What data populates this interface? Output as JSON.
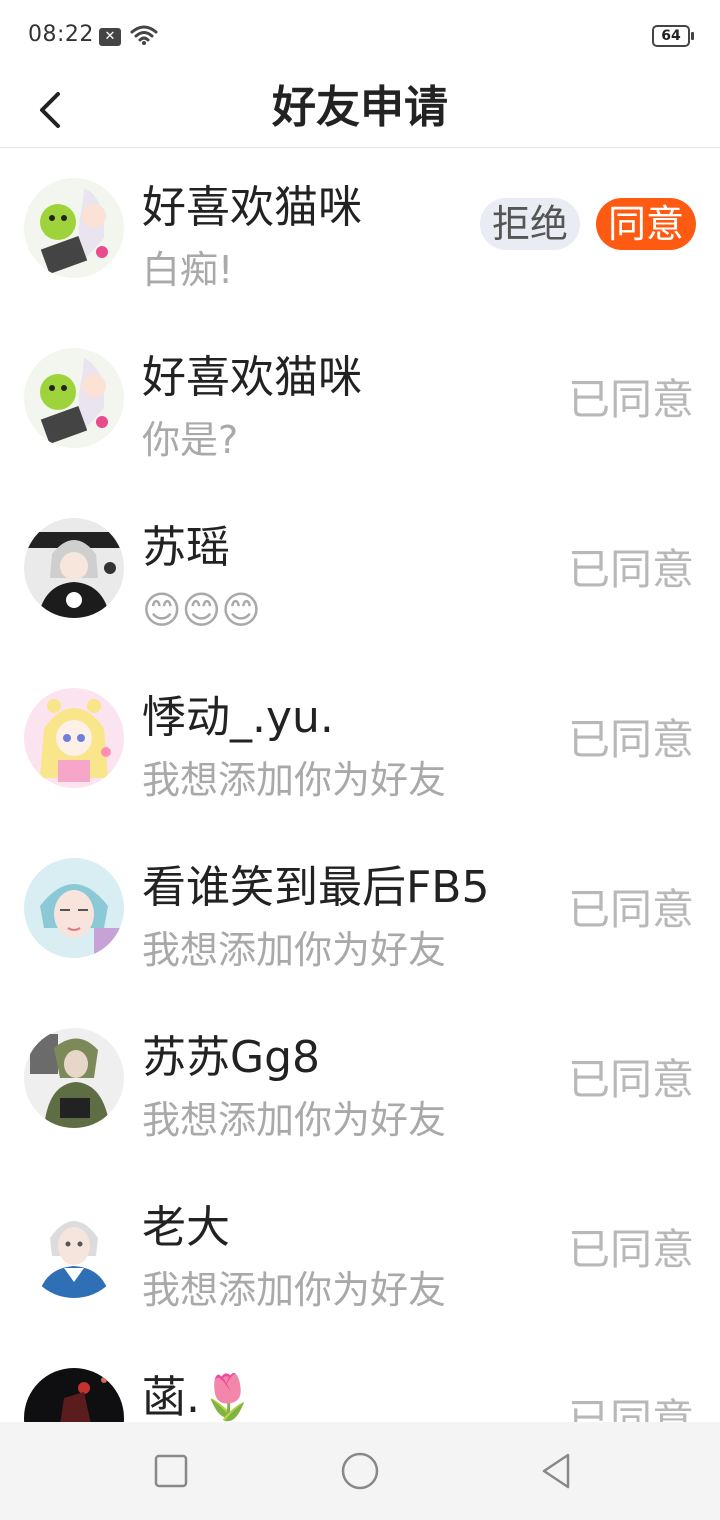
{
  "status_bar": {
    "time": "08:22",
    "notification_icon": "x-box-icon",
    "wifi_icon": "wifi-icon",
    "battery": "64"
  },
  "header": {
    "title": "好友申请",
    "back_icon": "chevron-left-icon"
  },
  "colors": {
    "accept": "#ff5a12",
    "reject_bg": "#e9ecf2",
    "status_text": "#b8b8b8",
    "message_text": "#a9a9a9"
  },
  "requests": [
    {
      "name": "好喜欢猫咪",
      "message": "白痴!",
      "reject_label": "拒绝",
      "accept_label": "同意",
      "status": ""
    },
    {
      "name": "好喜欢猫咪",
      "message": "你是?",
      "status": "已同意"
    },
    {
      "name": "苏瑶",
      "message": "😊😊😊",
      "status": "已同意"
    },
    {
      "name": "悸动_.yu.",
      "message": "我想添加你为好友",
      "status": "已同意"
    },
    {
      "name": "看谁笑到最后FB5",
      "message": "我想添加你为好友",
      "status": "已同意"
    },
    {
      "name": "苏苏Gg8",
      "message": "我想添加你为好友",
      "status": "已同意"
    },
    {
      "name": "老大",
      "message": "我想添加你为好友",
      "status": "已同意"
    },
    {
      "name": "菡.🌷",
      "message": "",
      "status": "已同意"
    }
  ],
  "nav": {
    "recent_icon": "square-icon",
    "home_icon": "circle-icon",
    "back_icon": "triangle-back-icon"
  }
}
